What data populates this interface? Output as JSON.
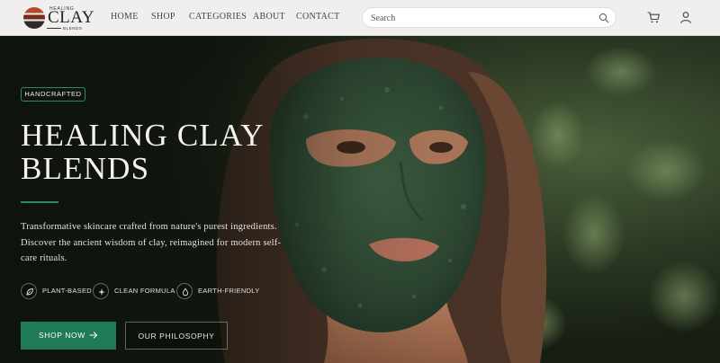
{
  "brand": {
    "logo_top": "HEALING",
    "logo_main": "CLAY",
    "logo_bottom": "BLENDS"
  },
  "nav": {
    "items": [
      {
        "label": "HOME"
      },
      {
        "label": "SHOP"
      },
      {
        "label": "CATEGORIES"
      },
      {
        "label": "ABOUT"
      },
      {
        "label": "CONTACT"
      }
    ]
  },
  "search": {
    "placeholder": "Search",
    "value": "",
    "icon": "search-icon"
  },
  "header_icons": [
    "cart-icon",
    "user-icon"
  ],
  "hero": {
    "badge": "HANDCRAFTED",
    "title_line1": "HEALING CLAY",
    "title_line2": "BLENDS",
    "description": "Transformative skincare crafted from nature's purest ingredients. Discover the ancient wisdom of clay, reimagined for modern self-care rituals.",
    "features": [
      {
        "icon": "leaf-icon",
        "label": "PLANT-BASED"
      },
      {
        "icon": "sparkle-icon",
        "label": "CLEAN FORMULA"
      },
      {
        "icon": "droplet-icon",
        "label": "EARTH-FRIENDLY"
      }
    ],
    "primary_button": "SHOP NOW",
    "secondary_button": "OUR PHILOSOPHY"
  },
  "colors": {
    "accent_green": "#1e7b56",
    "header_bg": "#f0efed",
    "hero_text": "#f6f3ee"
  }
}
